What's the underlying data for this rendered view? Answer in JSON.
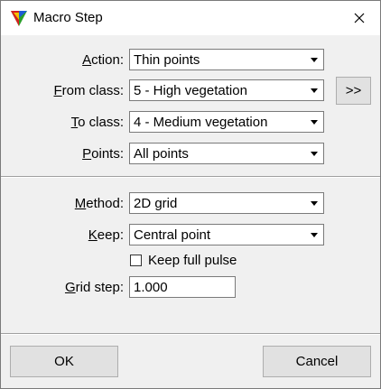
{
  "window": {
    "title": "Macro Step",
    "icon": "terrasolid-macro-icon",
    "close_icon": "close-icon"
  },
  "form": {
    "action": {
      "label_accel": "A",
      "label_rest": "ction:",
      "value": "Thin points"
    },
    "from_class": {
      "label_accel": "F",
      "label_rest": "rom class:",
      "value": "5 - High vegetation"
    },
    "more_button": ">>",
    "to_class": {
      "label_accel": "T",
      "label_rest": "o class:",
      "value": "4 - Medium vegetation"
    },
    "points": {
      "label_accel": "P",
      "label_rest": "oints:",
      "value": "All points"
    }
  },
  "thin": {
    "method": {
      "label_accel": "M",
      "label_rest": "ethod:",
      "value": "2D grid"
    },
    "keep": {
      "label_accel": "K",
      "label_rest": "eep:",
      "value": "Central point"
    },
    "keep_full_pulse": {
      "label": "Keep full pulse",
      "checked": false
    },
    "grid_step": {
      "label_accel": "G",
      "label_rest": "rid step:",
      "value": "1.000"
    }
  },
  "footer": {
    "ok": "OK",
    "cancel": "Cancel"
  }
}
